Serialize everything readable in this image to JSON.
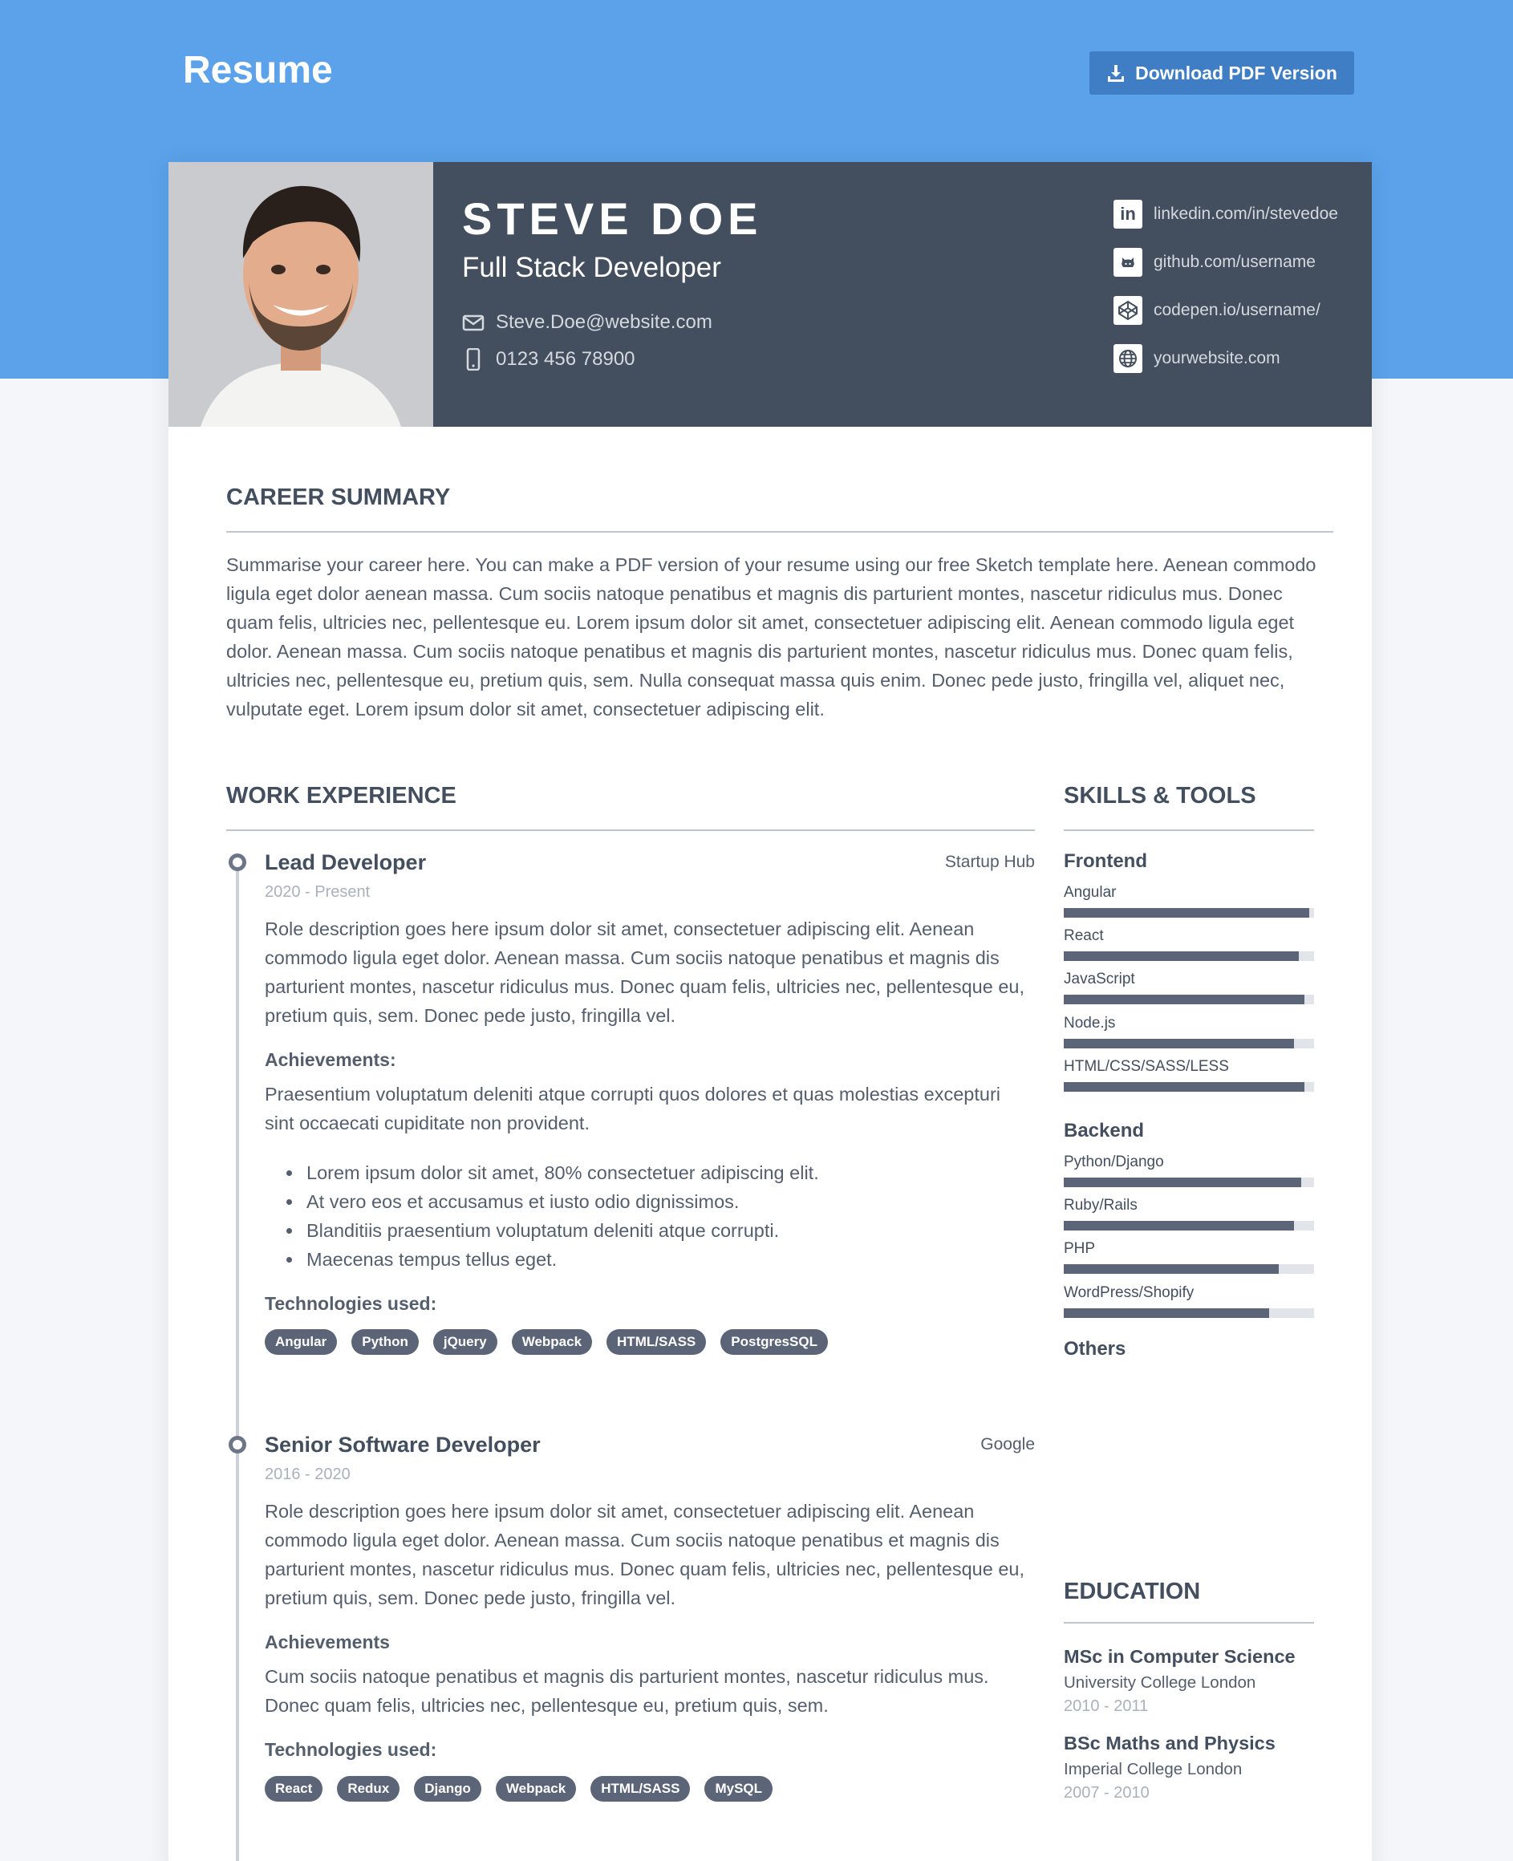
{
  "page": {
    "title": "Resume",
    "download_label": "Download PDF Version"
  },
  "profile": {
    "name": "STEVE DOE",
    "role": "Full Stack Developer",
    "email": "Steve.Doe@website.com",
    "phone": "0123 456 78900"
  },
  "social": [
    {
      "icon": "linkedin-icon",
      "label": "linkedin.com/in/stevedoe"
    },
    {
      "icon": "github-icon",
      "label": "github.com/username"
    },
    {
      "icon": "codepen-icon",
      "label": "codepen.io/username/"
    },
    {
      "icon": "globe-icon",
      "label": "yourwebsite.com"
    }
  ],
  "summary": {
    "title": "CAREER SUMMARY",
    "text": "Summarise your career here. You can make a PDF version of your resume using our free Sketch template here. Aenean commodo ligula eget dolor aenean massa. Cum sociis natoque penatibus et magnis dis parturient montes, nascetur ridiculus mus. Donec quam felis, ultricies nec, pellentesque eu. Lorem ipsum dolor sit amet, consectetuer adipiscing elit. Aenean commodo ligula eget dolor. Aenean massa. Cum sociis natoque penatibus et magnis dis parturient montes, nascetur ridiculus mus. Donec quam felis, ultricies nec, pellentesque eu, pretium quis, sem. Nulla consequat massa quis enim. Donec pede justo, fringilla vel, aliquet nec, vulputate eget. Lorem ipsum dolor sit amet, consectetuer adipiscing elit."
  },
  "work": {
    "title": "WORK EXPERIENCE",
    "jobs": [
      {
        "title": "Lead Developer",
        "company": "Startup Hub",
        "dates": "2020 - Present",
        "description": "Role description goes here ipsum dolor sit amet, consectetuer adipiscing elit. Aenean commodo ligula eget dolor. Aenean massa. Cum sociis natoque penatibus et magnis dis parturient montes, nascetur ridiculus mus. Donec quam felis, ultricies nec, pellentesque eu, pretium quis, sem. Donec pede justo, fringilla vel.",
        "achievements_label": "Achievements:",
        "achievements_text": "Praesentium voluptatum deleniti atque corrupti quos dolores et quas molestias excepturi sint occaecati cupiditate non provident.",
        "bullets": [
          "Lorem ipsum dolor sit amet, 80% consectetuer adipiscing elit.",
          "At vero eos et accusamus et iusto odio dignissimos.",
          "Blanditiis praesentium voluptatum deleniti atque corrupti.",
          "Maecenas tempus tellus eget."
        ],
        "tech_label": "Technologies used:",
        "tech": [
          "Angular",
          "Python",
          "jQuery",
          "Webpack",
          "HTML/SASS",
          "PostgresSQL"
        ]
      },
      {
        "title": "Senior Software Developer",
        "company": "Google",
        "dates": "2016 - 2020",
        "description": "Role description goes here ipsum dolor sit amet, consectetuer adipiscing elit. Aenean commodo ligula eget dolor. Aenean massa. Cum sociis natoque penatibus et magnis dis parturient montes, nascetur ridiculus mus. Donec quam felis, ultricies nec, pellentesque eu, pretium quis, sem. Donec pede justo, fringilla vel.",
        "achievements_label": "Achievements",
        "achievements_text": "Cum sociis natoque penatibus et magnis dis parturient montes, nascetur ridiculus mus. Donec quam felis, ultricies nec, pellentesque eu, pretium quis, sem.",
        "tech_label": "Technologies used:",
        "tech": [
          "React",
          "Redux",
          "Django",
          "Webpack",
          "HTML/SASS",
          "MySQL"
        ]
      }
    ]
  },
  "skills": {
    "title": "SKILLS & TOOLS",
    "frontend_label": "Frontend",
    "frontend": [
      {
        "name": "Angular",
        "level": 0.98
      },
      {
        "name": "React",
        "level": 0.94
      },
      {
        "name": "JavaScript",
        "level": 0.96
      },
      {
        "name": "Node.js",
        "level": 0.92
      },
      {
        "name": "HTML/CSS/SASS/LESS",
        "level": 0.96
      }
    ],
    "backend_label": "Backend",
    "backend": [
      {
        "name": "Python/Django",
        "level": 0.95
      },
      {
        "name": "Ruby/Rails",
        "level": 0.92
      },
      {
        "name": "PHP",
        "level": 0.86
      },
      {
        "name": "WordPress/Shopify",
        "level": 0.82
      }
    ],
    "others_label": "Others"
  },
  "education": {
    "title": "EDUCATION",
    "items": [
      {
        "degree": "MSc in Computer Science",
        "school": "University College London",
        "dates": "2010 - 2011"
      },
      {
        "degree": "BSc Maths and Physics",
        "school": "Imperial College London",
        "dates": "2007 - 2010"
      }
    ]
  },
  "colors": {
    "hero": "#5ba2ea",
    "header": "#434e5e",
    "button": "#3f7ec4",
    "tag": "#5b6577"
  }
}
